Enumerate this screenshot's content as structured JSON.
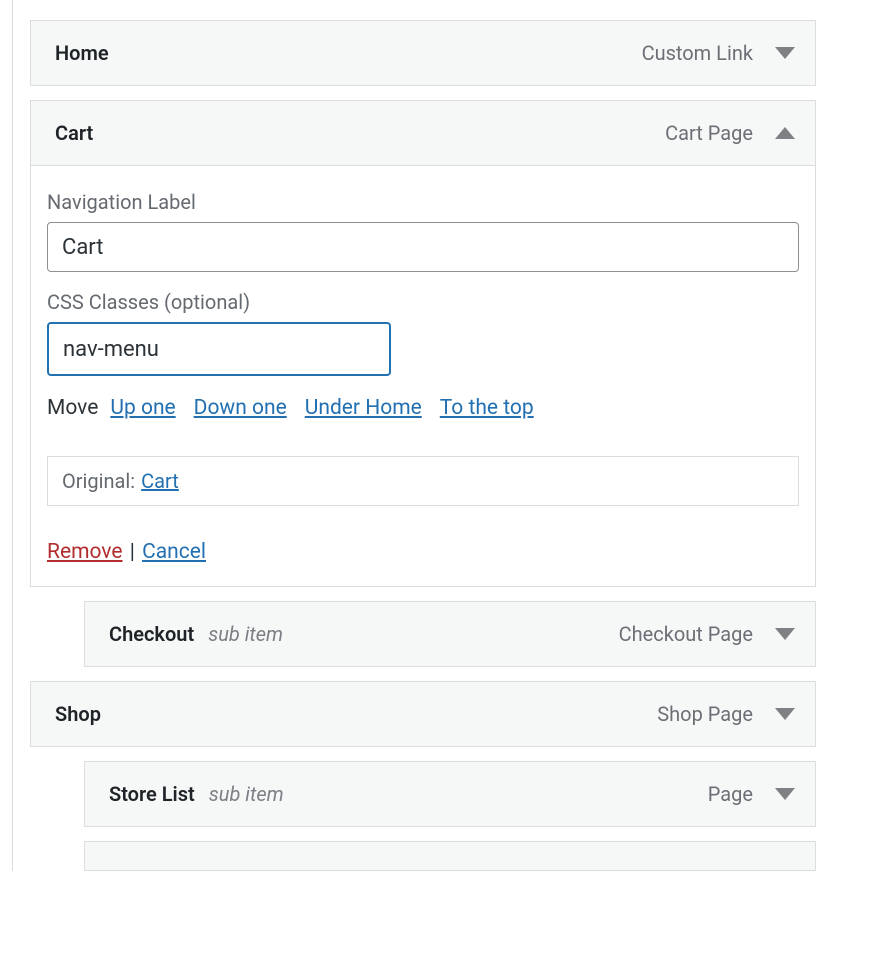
{
  "items": {
    "home": {
      "title": "Home",
      "type": "Custom Link"
    },
    "cart": {
      "title": "Cart",
      "type": "Cart Page",
      "nav_label_field": "Navigation Label",
      "nav_label_value": "Cart",
      "css_label": "CSS Classes (optional)",
      "css_value": "nav-menu",
      "move_label": "Move",
      "move": {
        "up": "Up one",
        "down": "Down one",
        "under": "Under Home",
        "top": "To the top"
      },
      "original_label": "Original:",
      "original_link": "Cart",
      "remove": "Remove",
      "cancel": "Cancel"
    },
    "checkout": {
      "title": "Checkout",
      "sub": "sub item",
      "type": "Checkout Page"
    },
    "shop": {
      "title": "Shop",
      "type": "Shop Page"
    },
    "storelist": {
      "title": "Store List",
      "sub": "sub item",
      "type": "Page"
    }
  }
}
